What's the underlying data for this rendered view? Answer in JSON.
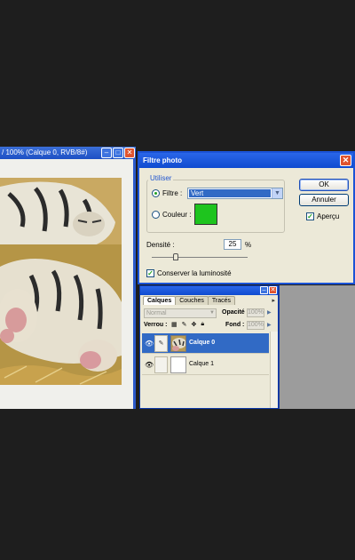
{
  "document": {
    "title": "/ 100% (Calque 0, RVB/8#)"
  },
  "filter_dialog": {
    "title": "Filtre photo",
    "group_label": "Utiliser",
    "filter_radio_label": "Filtre :",
    "filter_selected": "Vert",
    "color_radio_label": "Couleur :",
    "color_swatch": "#1ec41e",
    "ok_label": "OK",
    "cancel_label": "Annuler",
    "preview_label": "Aperçu",
    "density_label": "Densité :",
    "density_value": "25",
    "density_unit": "%",
    "density_percent": 25,
    "preserve_label": "Conserver la luminosité"
  },
  "layers_panel": {
    "tabs": [
      "Calques",
      "Couches",
      "Tracés"
    ],
    "blend_mode": "Normal",
    "opacity_label": "Opacité :",
    "opacity_value": "100%",
    "lock_label": "Verrou :",
    "fill_label": "Fond :",
    "fill_value": "100%",
    "layers": [
      {
        "name": "Calque 0"
      },
      {
        "name": "Calque 1"
      }
    ]
  }
}
